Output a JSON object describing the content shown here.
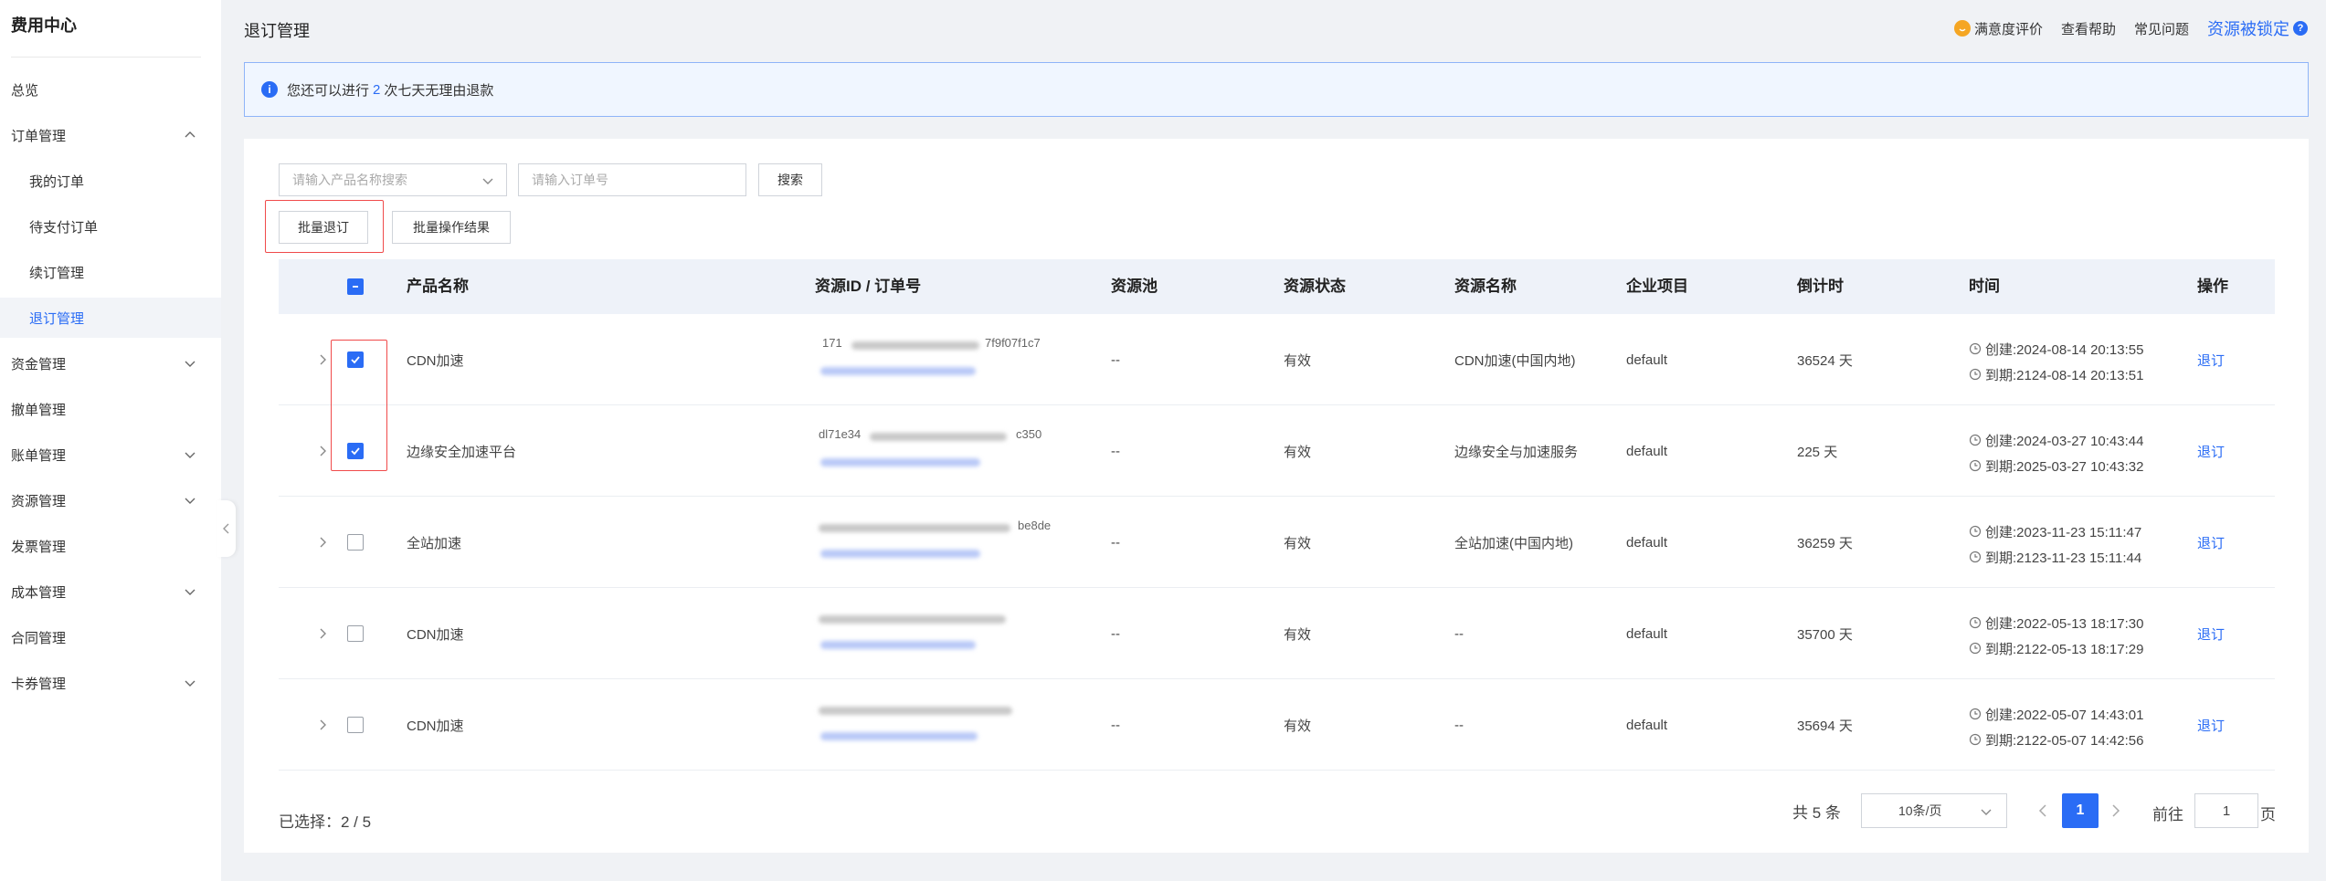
{
  "sidebar": {
    "title": "费用中心",
    "items": [
      {
        "label": "总览"
      },
      {
        "label": "订单管理"
      },
      {
        "label": "我的订单"
      },
      {
        "label": "待支付订单"
      },
      {
        "label": "续订管理"
      },
      {
        "label": "退订管理"
      },
      {
        "label": "资金管理"
      },
      {
        "label": "撤单管理"
      },
      {
        "label": "账单管理"
      },
      {
        "label": "资源管理"
      },
      {
        "label": "发票管理"
      },
      {
        "label": "成本管理"
      },
      {
        "label": "合同管理"
      },
      {
        "label": "卡券管理"
      }
    ]
  },
  "header": {
    "title": "退订管理",
    "satisfaction": "满意度评价",
    "help": "查看帮助",
    "faq": "常见问题",
    "locked": "资源被锁定"
  },
  "notice": {
    "prefix": "您还可以进行",
    "count": "2",
    "suffix": "次七天无理由退款"
  },
  "filters": {
    "product_placeholder": "请输入产品名称搜索",
    "order_placeholder": "请输入订单号",
    "search_label": "搜索",
    "batch_label": "批量退订",
    "result_label": "批量操作结果"
  },
  "table": {
    "headers": {
      "product": "产品名称",
      "resource_id": "资源ID / 订单号",
      "pool": "资源池",
      "status": "资源状态",
      "name": "资源名称",
      "project": "企业项目",
      "countdown": "倒计时",
      "time": "时间",
      "op": "操作"
    },
    "rows": [
      {
        "product": "CDN加速",
        "id_a": "171",
        "id_b": "7f9f07f1c7",
        "pool": "--",
        "status": "有效",
        "name": "CDN加速(中国内地)",
        "project": "default",
        "countdown": "36524 天",
        "created": "创建:2024-08-14 20:13:55",
        "expires": "到期:2124-08-14 20:13:51",
        "op": "退订"
      },
      {
        "product": "边缘安全加速平台",
        "id_a": "dl71e34",
        "id_b": "c350",
        "pool": "--",
        "status": "有效",
        "name": "边缘安全与加速服务",
        "project": "default",
        "countdown": "225 天",
        "created": "创建:2024-03-27 10:43:44",
        "expires": "到期:2025-03-27 10:43:32",
        "op": "退订"
      },
      {
        "product": "全站加速",
        "id_a": "",
        "id_b": "be8de",
        "pool": "--",
        "status": "有效",
        "name": "全站加速(中国内地)",
        "project": "default",
        "countdown": "36259 天",
        "created": "创建:2023-11-23 15:11:47",
        "expires": "到期:2123-11-23 15:11:44",
        "op": "退订"
      },
      {
        "product": "CDN加速",
        "id_a": "",
        "id_b": "",
        "pool": "--",
        "status": "有效",
        "name": "--",
        "project": "default",
        "countdown": "35700 天",
        "created": "创建:2022-05-13 18:17:30",
        "expires": "到期:2122-05-13 18:17:29",
        "op": "退订"
      },
      {
        "product": "CDN加速",
        "id_a": "",
        "id_b": "",
        "pool": "--",
        "status": "有效",
        "name": "--",
        "project": "default",
        "countdown": "35694 天",
        "created": "创建:2022-05-07 14:43:01",
        "expires": "到期:2122-05-07 14:42:56",
        "op": "退订"
      }
    ]
  },
  "footer": {
    "selected": "已选择：2 / 5",
    "total": "共 5 条",
    "page_size": "10条/页",
    "current_page": "1",
    "goto_prefix": "前往",
    "goto_value": "1",
    "goto_suffix": "页"
  },
  "colors": {
    "accent": "#2a6cf5",
    "highlight_frame": "#f04a4a"
  }
}
